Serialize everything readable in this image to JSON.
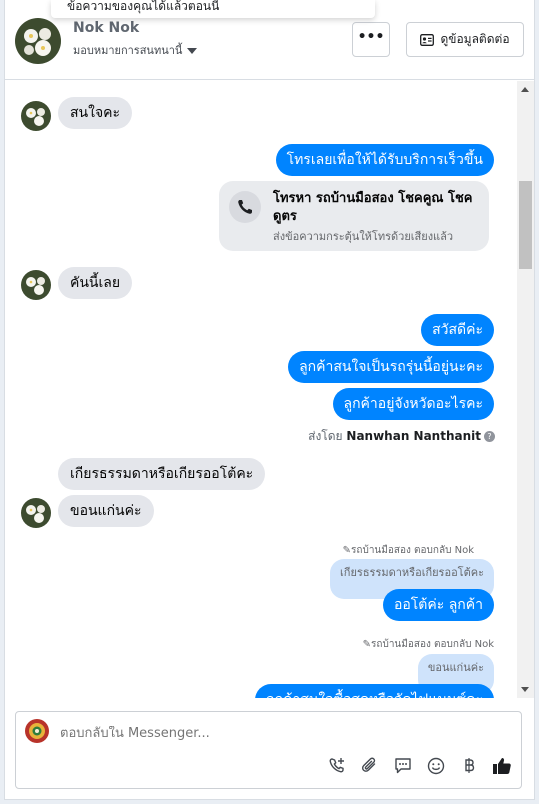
{
  "header": {
    "toast_text": "ข้อความของคุณได้แล้วตอนนี้",
    "name": "Nok Nok",
    "assign_label": "มอบหมายการสนทนานี้",
    "more_label": "•••",
    "contact_button": "ดูข้อมูลติดต่อ"
  },
  "messages": {
    "m1": "สนใจคะ",
    "m2": "โทรเลยเพื่อให้ได้รับบริการเร็วขึ้น",
    "call_title": "โทรหา รถบ้านมือสอง โชคคูณ โชคดูตร",
    "call_sub": "ส่งข้อความกระตุ้นให้โทรด้วยเสียงแล้ว",
    "m3": "คันนี้เลย",
    "m4": "สวัสดีค่ะ",
    "m5": "ลูกค้าสนใจเป็นรถรุ่นนี้อยู่นะคะ",
    "m6": "ลูกค้าอยู่จังหวัดอะไรคะ",
    "sent_by_prefix": "ส่งโดย",
    "sent_by_name": "Nanwhan Nanthanit",
    "help_glyph": "?",
    "m7": "เกียรธรรมดาหรือเกียรออโต้คะ",
    "m8": "ขอนแก่นค่ะ",
    "reply1_header": "รถบ้านมือสอง ตอบกลับ Nok",
    "reply1_quote": "เกียรธรรมดาหรือเกียรออโต้คะ",
    "reply1_msg": "ออโต้ค่ะ ลูกค้า",
    "reply2_header": "รถบ้านมือสอง ตอบกลับ Nok",
    "reply2_quote": "ขอนแก่นค่ะ",
    "reply2_msg": "ลูกค้าสนใจซื้อสดหรือจัดไฟแนนซ์คะ"
  },
  "composer": {
    "placeholder": "ตอบกลับใน Messenger..."
  },
  "icons": [
    "more-icon",
    "contact-card-icon",
    "phone-icon",
    "help-icon",
    "call-add-icon",
    "attach-icon",
    "saved-reply-icon",
    "emoji-icon",
    "currency-icon",
    "thumbs-up-icon"
  ],
  "colors": {
    "outgoing": "#0084ff",
    "incoming": "#e4e6eb",
    "quote": "#cfe3fb"
  }
}
